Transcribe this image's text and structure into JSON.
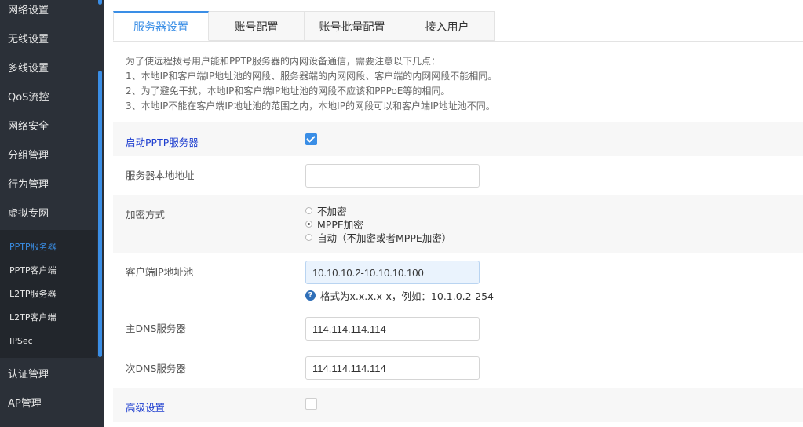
{
  "sidebar": {
    "main_items": [
      {
        "label": "网络设置"
      },
      {
        "label": "无线设置"
      },
      {
        "label": "多线设置"
      },
      {
        "label": "QoS流控"
      },
      {
        "label": "网络安全"
      },
      {
        "label": "分组管理"
      },
      {
        "label": "行为管理"
      },
      {
        "label": "虚拟专网"
      }
    ],
    "sub_items": [
      {
        "label": "PPTP服务器"
      },
      {
        "label": "PPTP客户端"
      },
      {
        "label": "L2TP服务器"
      },
      {
        "label": "L2TP客户端"
      },
      {
        "label": "IPSec"
      }
    ],
    "bottom_items": [
      {
        "label": "认证管理"
      },
      {
        "label": "AP管理"
      }
    ],
    "active_sub": "PPTP服务器"
  },
  "tabs": [
    {
      "label": "服务器设置"
    },
    {
      "label": "账号配置"
    },
    {
      "label": "账号批量配置"
    },
    {
      "label": "接入用户"
    }
  ],
  "active_tab": "服务器设置",
  "notice": {
    "lines": [
      "为了使远程拨号用户能和PPTP服务器的内网设备通信，需要注意以下几点：",
      "1、本地IP和客户端IP地址池的网段、服务器端的内网网段、客户端的内网网段不能相同。",
      "2、为了避免干扰，本地IP和客户端IP地址池的网段不应该和PPPoE等的相同。",
      "3、本地IP不能在客户端IP地址池的范围之内，本地IP的网段可以和客户端IP地址池不同。"
    ]
  },
  "form": {
    "enable_pptp": {
      "label": "启动PPTP服务器",
      "checked": true
    },
    "local_addr": {
      "label": "服务器本地地址",
      "value": ""
    },
    "encryption": {
      "label": "加密方式",
      "options": [
        "不加密",
        "MPPE加密",
        "自动（不加密或者MPPE加密）"
      ],
      "selected": "MPPE加密"
    },
    "client_pool": {
      "label": "客户端IP地址池",
      "value": "10.10.10.2-10.10.10.100",
      "hint": "格式为x.x.x.x-x，例如：10.1.0.2-254"
    },
    "primary_dns": {
      "label": "主DNS服务器",
      "value": "114.114.114.114"
    },
    "secondary_dns": {
      "label": "次DNS服务器",
      "value": "114.114.114.114"
    },
    "advanced": {
      "label": "高级设置",
      "checked": false
    }
  },
  "colors": {
    "accent": "#3a8ee6",
    "sidebar_bg": "#2b3038",
    "label_blue": "#1f3fd0"
  }
}
